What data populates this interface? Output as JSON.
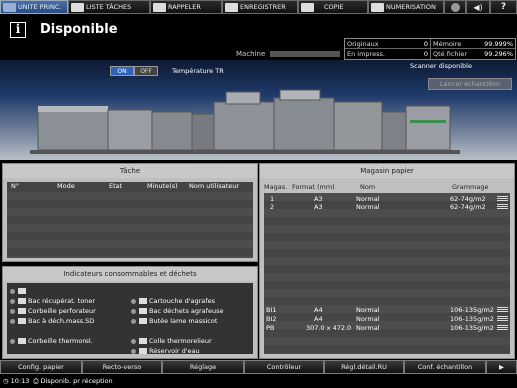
{
  "tabs": [
    {
      "label": "UNITE PRINC.",
      "icon": "home-icon",
      "active": true
    },
    {
      "label": "LISTE TÂCHES",
      "icon": "list-icon",
      "active": false
    },
    {
      "label": "RAPPELER",
      "icon": "recall-icon",
      "active": false
    },
    {
      "label": "ENREGISTRER",
      "icon": "save-icon",
      "active": false
    },
    {
      "label": "COPIE",
      "icon": "copy-icon",
      "active": false
    },
    {
      "label": "NUMERISATION",
      "icon": "scan-icon",
      "active": false
    }
  ],
  "header": {
    "status": "Disponible",
    "machine_label": "Machine"
  },
  "counters": {
    "originals_label": "Originaux",
    "originals_value": "0",
    "memory_label": "Mémoire",
    "memory_value": "99.999%",
    "printing_label": "En impress.",
    "printing_value": "0",
    "file_label": "Qté fichier",
    "file_value": "99.296%"
  },
  "temperature": {
    "on_label": "ON",
    "off_label": "OFF",
    "label": "Température TR",
    "state": "on"
  },
  "scanner": {
    "status": "Scanner disponible",
    "button": "Lancer échantillon"
  },
  "task_panel": {
    "title": "Tâche",
    "columns": [
      "N°",
      "Mode",
      "Etat",
      "Minute(s)",
      "Nom utilisateur"
    ]
  },
  "indicators": {
    "title": "Indicateurs consommables et déchets",
    "items": [
      {
        "label": "Bac récupérat. toner"
      },
      {
        "label": "Corbeille perforateur"
      },
      {
        "label": "Bac à déch.mass.SD"
      },
      {
        "label": "Corbeille thermorel."
      },
      {
        "label": "Cartouche d'agrafes"
      },
      {
        "label": "Bac déchets agrafeuse"
      },
      {
        "label": "Butée lame massicot"
      },
      {
        "label": "Colle thermorelieur"
      },
      {
        "label": "Réservoir d'eau"
      }
    ]
  },
  "paper_panel": {
    "title": "Magasin papier",
    "columns": [
      "Magas.",
      "Format (mm)",
      "Nom",
      "Grammage"
    ],
    "rows": [
      {
        "tray": "1",
        "format": "A3",
        "name": "Normal",
        "weight": "62-74g/m2"
      },
      {
        "tray": "2",
        "format": "A3",
        "name": "Normal",
        "weight": "62-74g/m2"
      },
      {
        "tray": "BI1",
        "format": "A4",
        "name": "Normal",
        "weight": "106-135g/m2"
      },
      {
        "tray": "BI2",
        "format": "A4",
        "name": "Normal",
        "weight": "106-135g/m2"
      },
      {
        "tray": "PB",
        "format": "307.0 x 472.0",
        "name": "Normal",
        "weight": "106-135g/m2"
      }
    ]
  },
  "bottom_buttons": [
    "Config. papier",
    "Recto-verso",
    "Réglage",
    "Contrôleur",
    "Régl.détail.RU",
    "Conf. échantillon"
  ],
  "statusbar": {
    "time": "10:13",
    "message": "Disponib. pr réception"
  },
  "colors": {
    "active_tab": "#274b86",
    "on_button": "#2f64b9",
    "panel": "#bfbfbf"
  }
}
